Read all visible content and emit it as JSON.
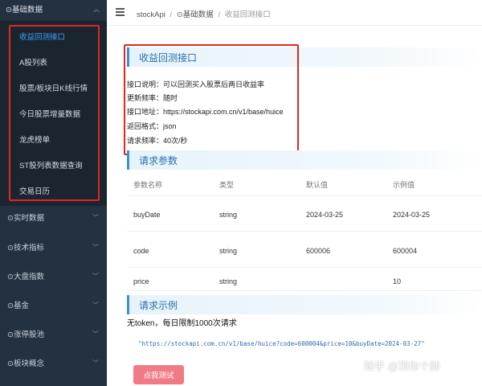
{
  "sidebar": {
    "section_title": "⊙基础数据",
    "sub_items": [
      {
        "label": "收益回测接口",
        "active": true
      },
      {
        "label": "A股列表"
      },
      {
        "label": "股票/板块日K线行情"
      },
      {
        "label": "今日股票增量数据"
      },
      {
        "label": "龙虎榜单"
      },
      {
        "label": "ST股列表数据查询"
      },
      {
        "label": "交易日历"
      }
    ],
    "menu_items": [
      {
        "label": "⊙实时数据"
      },
      {
        "label": "⊙技术指标"
      },
      {
        "label": "⊙大盘指数"
      },
      {
        "label": "⊙基金"
      },
      {
        "label": "⊙涨停股池"
      },
      {
        "label": "⊙板块概念"
      }
    ]
  },
  "header": {
    "app_name": "stockApi",
    "crumb_section": "⊙基础数据",
    "crumb_current": "收益回测接口",
    "sep": "/"
  },
  "api_info": {
    "title": "收益回测接口",
    "description": "接口说明：可以回测买入股票后两日收益率",
    "frequency": "更新频率：随时",
    "address": "接口地址：https://stockapi.com.cn/v1/base/huice",
    "format": "返回格式：json",
    "rate": "请求频率：40次/秒"
  },
  "params": {
    "title": "请求参数",
    "columns": [
      "参数名称",
      "类型",
      "默认值",
      "示例值"
    ],
    "rows": [
      {
        "name": "buyDate",
        "type": "string",
        "default": "2024-03-25",
        "example": "2024-03-25"
      },
      {
        "name": "code",
        "type": "string",
        "default": "600006",
        "example": "600004"
      },
      {
        "name": "price",
        "type": "string",
        "default": "",
        "example": "10"
      }
    ]
  },
  "example": {
    "title": "请求示例",
    "notice": "无token，每日限制1000次请求",
    "url": "\"https://stockapi.com.cn/v1/base/huice?code=600004&price=10&buyDate=2024-03-27\"",
    "button": "点我测试"
  },
  "watermark": "知乎 @顶你个肺",
  "colors": {
    "sidebar_bg": "#243140",
    "submenu_bg": "#1b2530",
    "active": "#3ba0f5",
    "highlight_box": "#e0271f",
    "section_accent": "#3b8fd8",
    "button": "#f07b86"
  }
}
